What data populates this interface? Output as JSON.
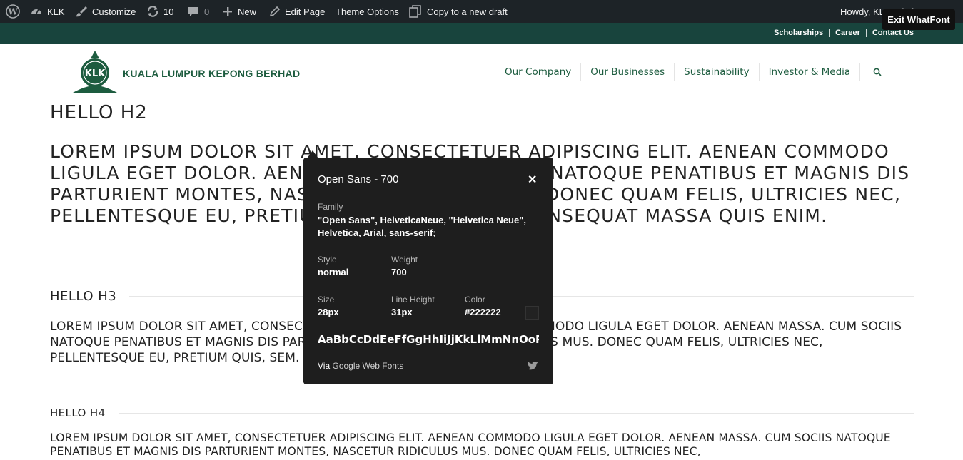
{
  "admin_bar": {
    "wp_logo_icon": "wordpress-icon",
    "site_name": "KLK",
    "customize": "Customize",
    "updates_count": "10",
    "comments_count": "0",
    "new": "New",
    "edit_page": "Edit Page",
    "theme_options": "Theme Options",
    "copy_draft": "Copy to a new draft",
    "howdy": "Howdy, KLK Admin"
  },
  "whatfont_exit": "Exit WhatFont",
  "top_links": [
    "Scholarships",
    "Career",
    "Contact Us"
  ],
  "logo": {
    "text": "KUALA LUMPUR KEPONG BERHAD",
    "mark_text": "KLK"
  },
  "nav": [
    "Our Company",
    "Our Businesses",
    "Sustainability",
    "Investor & Media"
  ],
  "content": {
    "h2": "HELLO H2",
    "p2": "Lorem ipsum dolor sit amet, consectetuer adipiscing elit. Aenean commodo ligula eget dolor. Aenean massa. Cum sociis natoque penatibus et magnis dis parturient montes, nascetur ridiculus mus. Donec quam felis, ultricies nec, pellentesque eu, pretium quis, sem. Nulla consequat massa quis enim.",
    "h3": "HELLO H3",
    "p3": "Lorem ipsum dolor sit amet, consectetuer adipiscing elit. Aenean commodo ligula eget dolor. Aenean massa. Cum sociis natoque penatibus et magnis dis parturient montes, nascetur ridiculus mus. Donec quam felis, ultricies nec, pellentesque eu, pretium quis, sem. Nulla consequat massa quis enim.",
    "h4": "HELLO H4",
    "p4": "Lorem ipsum dolor sit amet, consectetuer adipiscing elit. Aenean commodo ligula eget dolor. Aenean massa. Cum sociis natoque penatibus et magnis dis parturient montes, nascetur ridiculus mus. Donec quam felis, ultricies nec,"
  },
  "whatfont_panel": {
    "title": "Open Sans - 700",
    "family_label": "Family",
    "family_value": "\"Open Sans\", HelveticaNeue, \"Helvetica Neue\", Helvetica, Arial, sans-serif;",
    "style_label": "Style",
    "style_value": "normal",
    "weight_label": "Weight",
    "weight_value": "700",
    "size_label": "Size",
    "size_value": "28px",
    "line_height_label": "Line Height",
    "line_height_value": "31px",
    "color_label": "Color",
    "color_value": "#222222",
    "sample": "AaBbCcDdEeFfGgHhIiJjKkLlMmNnOoPpQqRrSsTtUuVvWwXxYyZz",
    "via": "Via",
    "via_source": "Google Web Fonts"
  },
  "colors": {
    "admin_bar_bg": "#1d2327",
    "top_strip_bg": "#18443d",
    "brand_green": "#1d5c3f",
    "panel_bg": "#1e1e1e",
    "text": "#222222"
  }
}
